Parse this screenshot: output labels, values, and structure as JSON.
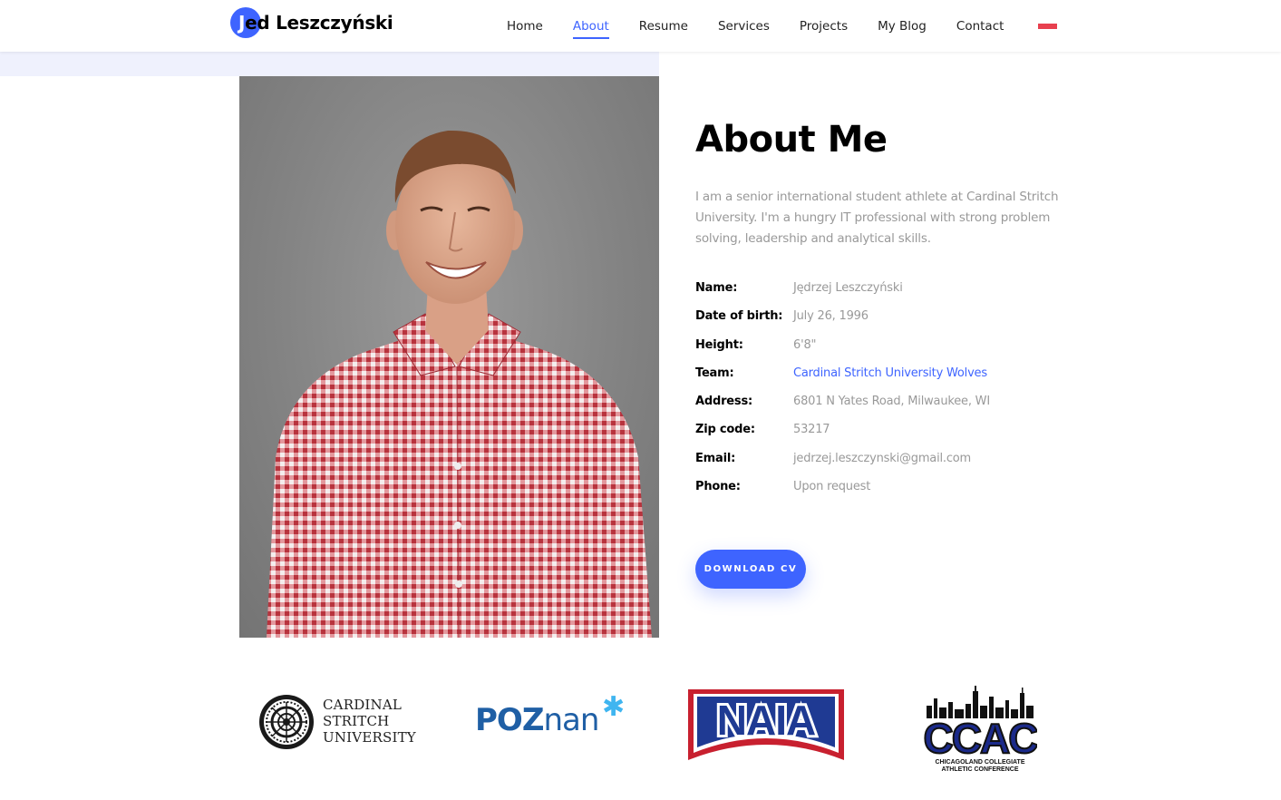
{
  "header": {
    "brand_first": "J",
    "brand_rest": "ed Leszczyński",
    "nav": [
      "Home",
      "About",
      "Resume",
      "Services",
      "Projects",
      "My Blog",
      "Contact"
    ],
    "active_nav": "About",
    "flag_icon": "poland-flag-icon"
  },
  "about": {
    "title": "About Me",
    "intro": "I am a senior international student athlete at Cardinal Stritch University. I'm a hungry IT professional with strong problem solving, leadership and analytical skills.",
    "details": [
      {
        "label": "Name:",
        "value": "Jędrzej Leszczyński"
      },
      {
        "label": "Date of birth:",
        "value": "July 26, 1996"
      },
      {
        "label": "Height:",
        "value": "6'8\""
      },
      {
        "label": "Team:",
        "value": "Cardinal Stritch University Wolves"
      },
      {
        "label": "Address:",
        "value": "6801 N Yates Road, Milwaukee, WI"
      },
      {
        "label": "Zip code:",
        "value": "53217"
      },
      {
        "label": "Email:",
        "value": "jedrzej.leszczynski@gmail.com"
      },
      {
        "label": "Phone:",
        "value": "Upon request"
      }
    ],
    "download_label": "Download CV"
  },
  "logos": {
    "cardinal_stritch": {
      "line1": "CARDINAL",
      "line2": "STRITCH",
      "line3": "UNIVERSITY"
    },
    "poznan": {
      "upper": "POZ",
      "lower": "nan"
    },
    "naia": {
      "text": "NAIA"
    },
    "ccac": {
      "text": "CCAC",
      "sub1": "CHICAGOLAND COLLEGIATE",
      "sub2": "ATHLETIC CONFERENCE"
    }
  },
  "colors": {
    "accent": "#3e64ff",
    "muted_text": "#999999",
    "hero_strip": "#eff1fd",
    "naia_red": "#c8202f",
    "naia_blue": "#1f3a93",
    "poznan_blue": "#1f5fa5",
    "ccac_navy": "#1b2a8a"
  }
}
